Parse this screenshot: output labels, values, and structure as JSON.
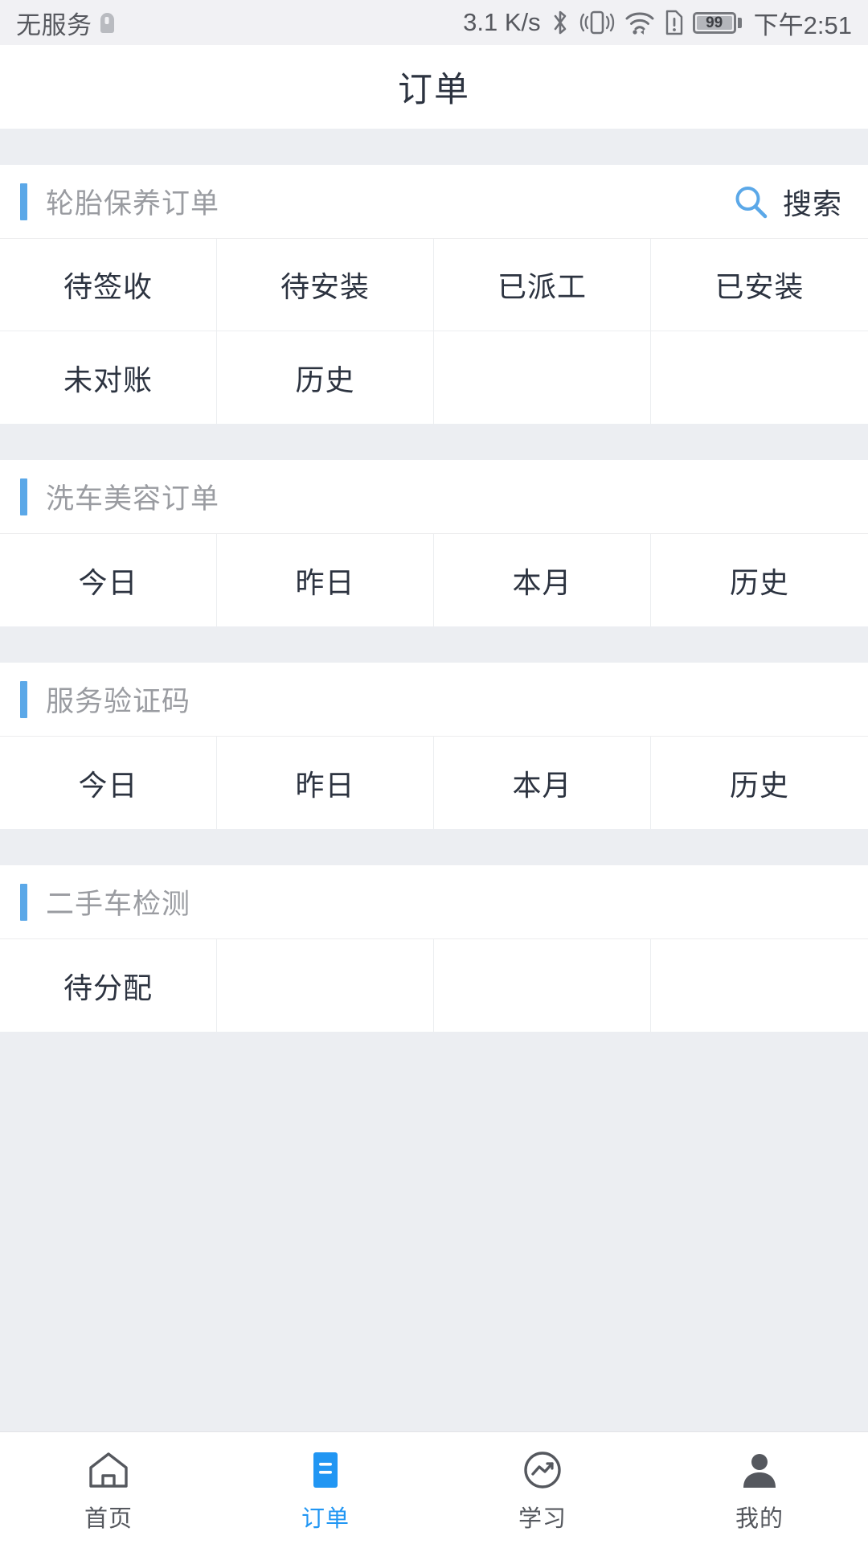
{
  "status_bar": {
    "carrier": "无服务",
    "sim_icon": "sim-card-icon",
    "network_speed": "3.1 K/s",
    "bluetooth_icon": "bluetooth-icon",
    "vibrate_icon": "vibrate-icon",
    "wifi_icon": "wifi-icon",
    "sim_alert_icon": "sim-alert-icon",
    "battery_level": "99",
    "battery_icon": "battery-icon",
    "time": "下午2:51"
  },
  "header": {
    "title": "订单"
  },
  "theme": {
    "accent": "#5ba8e8",
    "active_tab": "#2196f3",
    "text": "#2c3340",
    "muted": "#9a9ca1",
    "page_bg": "#eceef2",
    "card_bg": "#ffffff"
  },
  "sections": [
    {
      "title": "轮胎保养订单",
      "accent_icon": "accent-bar",
      "search": {
        "icon": "search-icon",
        "label": "搜索"
      },
      "items": [
        "待签收",
        "待安装",
        "已派工",
        "已安装",
        "未对账",
        "历史",
        "",
        ""
      ]
    },
    {
      "title": "洗车美容订单",
      "accent_icon": "accent-bar",
      "search": null,
      "items": [
        "今日",
        "昨日",
        "本月",
        "历史"
      ]
    },
    {
      "title": "服务验证码",
      "accent_icon": "accent-bar",
      "search": null,
      "items": [
        "今日",
        "昨日",
        "本月",
        "历史"
      ]
    },
    {
      "title": "二手车检测",
      "accent_icon": "accent-bar",
      "search": null,
      "items": [
        "待分配",
        "",
        "",
        ""
      ]
    }
  ],
  "tabbar": {
    "items": [
      {
        "label": "首页",
        "icon": "home-icon",
        "active": false
      },
      {
        "label": "订单",
        "icon": "order-list-icon",
        "active": true
      },
      {
        "label": "学习",
        "icon": "chart-circle-icon",
        "active": false
      },
      {
        "label": "我的",
        "icon": "person-icon",
        "active": false
      }
    ]
  }
}
